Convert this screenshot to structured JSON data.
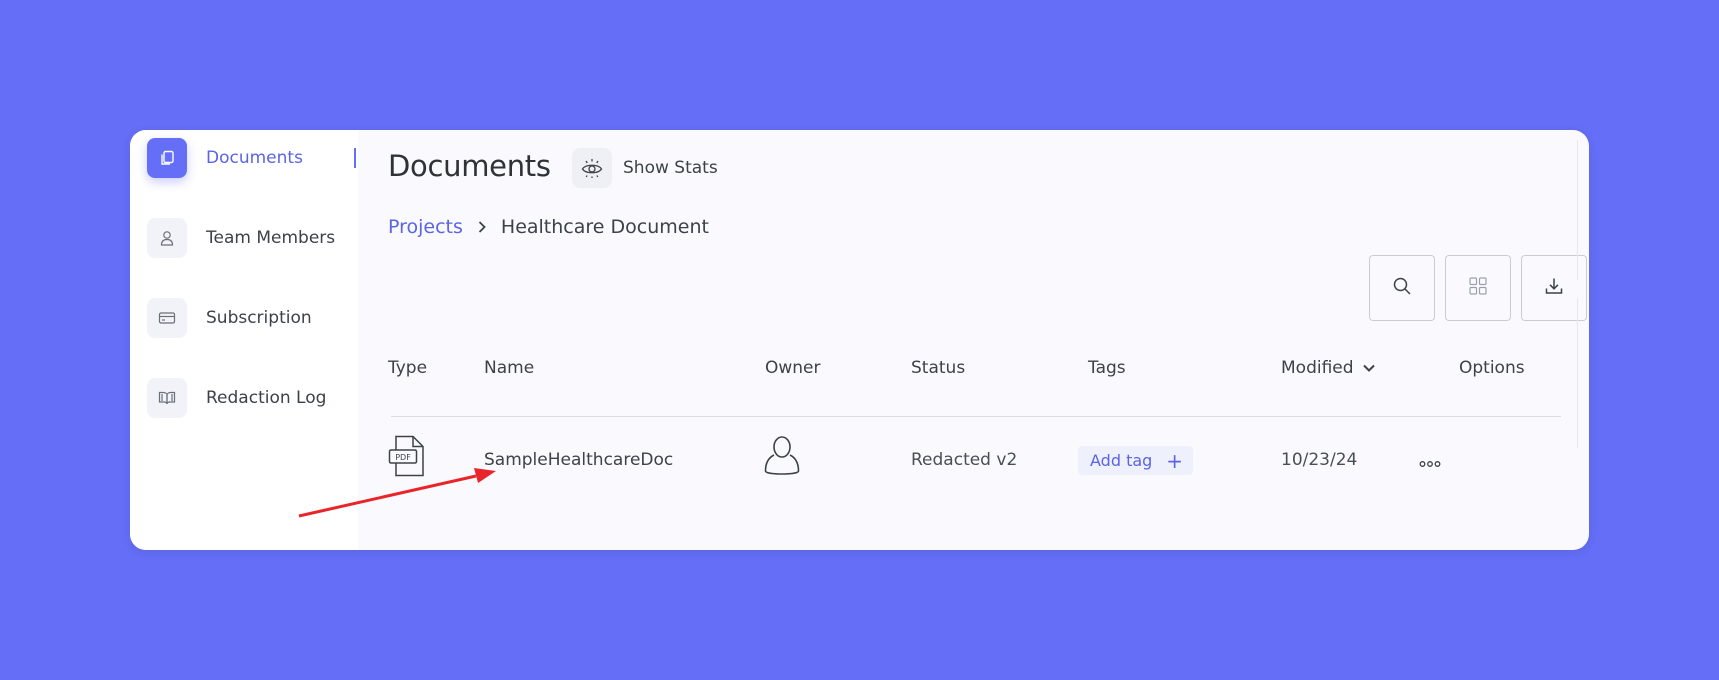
{
  "sidebar": {
    "items": [
      {
        "label": "Documents",
        "icon": "copy-icon",
        "active": true
      },
      {
        "label": "Team Members",
        "icon": "user-icon",
        "active": false
      },
      {
        "label": "Subscription",
        "icon": "credit-card-icon",
        "active": false
      },
      {
        "label": "Redaction Log",
        "icon": "book-icon",
        "active": false
      }
    ]
  },
  "header": {
    "title": "Documents",
    "show_stats_label": "Show Stats",
    "show_stats_icon": "eye-icon"
  },
  "breadcrumb": {
    "parent": "Projects",
    "current": "Healthcare Document"
  },
  "toolbar": {
    "buttons": [
      "search-icon",
      "grid-icon",
      "download-icon"
    ]
  },
  "table": {
    "columns": [
      "Type",
      "Name",
      "Owner",
      "Status",
      "Tags",
      "Modified",
      "Options"
    ],
    "sort_column": "Modified",
    "sort_direction": "descending",
    "rows": [
      {
        "type": "PDF",
        "name": "SampleHealthcareDoc",
        "owner_icon": "user-avatar-icon",
        "status": "Redacted v2",
        "tag_button": "Add tag",
        "modified": "10/23/24",
        "options_icon": "more-options-icon"
      }
    ]
  },
  "colors": {
    "background": "#646ef6",
    "accent": "#5a64e6",
    "annotation_arrow": "#e8262a"
  }
}
